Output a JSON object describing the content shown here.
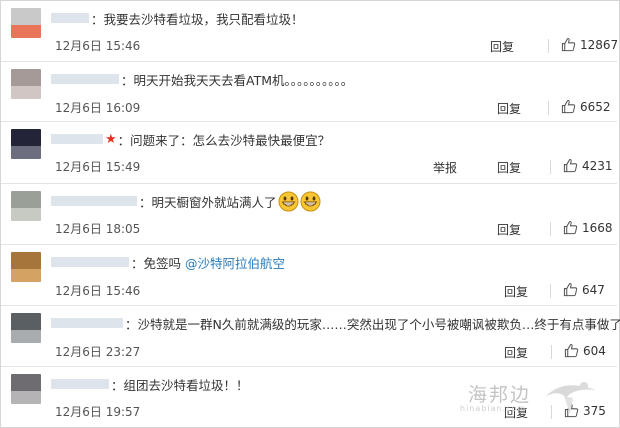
{
  "comments": [
    {
      "text": "：我要去沙特看垃圾，我只配看垃圾！",
      "time": "12月6日 15:46",
      "actions": [
        "回复"
      ],
      "likes": "12867",
      "avatar_colors": [
        "#c9c9c9",
        "#e8755a"
      ],
      "uname_width": 38
    },
    {
      "text": "：明天开始我天天去看ATM机。。。。。。。。。。",
      "time": "12月6日 16:09",
      "actions": [
        "回复"
      ],
      "likes": "6652",
      "avatar_colors": [
        "#a59a98",
        "#d1c6c3"
      ],
      "uname_width": 68
    },
    {
      "text": "：问题来了：怎么去沙特最快最便宜？",
      "time": "12月6日 15:49",
      "actions": [
        "举报",
        "回复"
      ],
      "likes": "4231",
      "avatar_colors": [
        "#242438",
        "#6b6e7f"
      ],
      "uname_width": 52,
      "star": true
    },
    {
      "text": "：明天橱窗外就站满人了",
      "time": "12月6日 18:05",
      "actions": [
        "回复"
      ],
      "likes": "1668",
      "avatar_colors": [
        "#9aa098",
        "#c6cac3"
      ],
      "uname_width": 86,
      "emoji": true
    },
    {
      "text": "：免签吗",
      "mention": "@沙特阿拉伯航空",
      "time": "12月6日 15:46",
      "actions": [
        "回复"
      ],
      "likes": "647",
      "avatar_colors": [
        "#a5753c",
        "#d4a262"
      ],
      "uname_width": 78
    },
    {
      "text": "：沙特就是一群N久前就满级的玩家……突然出现了个小号被嘲讽被欺负…终于有点事做了…",
      "time": "12月6日 23:27",
      "actions": [
        "回复"
      ],
      "likes": "604",
      "avatar_colors": [
        "#5a5f64",
        "#a9acae"
      ],
      "uname_width": 72
    },
    {
      "text": "：组团去沙特看垃圾！！",
      "time": "12月6日 19:57",
      "actions": [
        "回复"
      ],
      "likes": "375",
      "avatar_colors": [
        "#6e6c70",
        "#b5b3b6"
      ],
      "uname_width": 58
    }
  ],
  "watermark": {
    "text": "海邦边",
    "sub": "hinabian.com"
  }
}
